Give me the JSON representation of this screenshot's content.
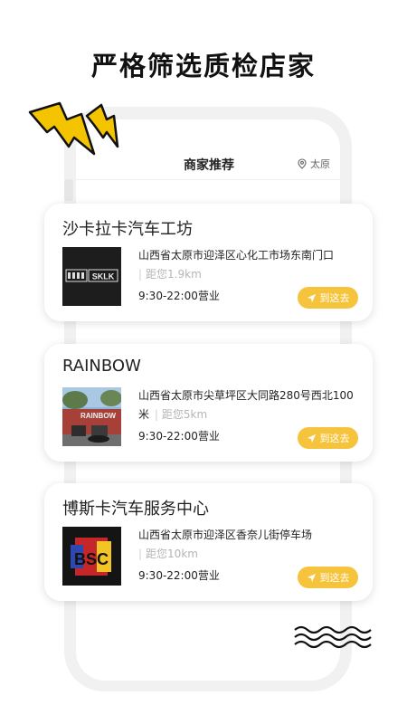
{
  "headline": "严格筛选质检店家",
  "header": {
    "title": "商家推荐",
    "city": "太原",
    "location_icon": "map-pin-icon"
  },
  "merchants": [
    {
      "name": "沙卡拉卡汽车工坊",
      "logo_text": "SKLK",
      "address": "山西省太原市迎泽区心化工市场东南门口",
      "distance": "距您1.9km",
      "hours": "9:30-22:00营业",
      "action": "到这去"
    },
    {
      "name": "RAINBOW",
      "logo_text": "RAINBOW",
      "address": "山西省太原市尖草坪区大同路280号西北100米",
      "distance": "距您5km",
      "hours": "9:30-22:00营业",
      "action": "到这去"
    },
    {
      "name": "博斯卡汽车服务中心",
      "logo_text": "BSC",
      "address": "山西省太原市迎泽区香奈儿街停车场",
      "distance": "距您10km",
      "hours": "9:30-22:00营业",
      "action": "到这去"
    }
  ],
  "colors": {
    "accent": "#f6c43c",
    "lightning": "#f5c400",
    "distance_text": "#b5b5b5"
  },
  "icons": {
    "go": "navigation-arrow-icon",
    "decoration_top": "lightning-bolt-icon",
    "decoration_bottom": "wave-lines-icon"
  }
}
